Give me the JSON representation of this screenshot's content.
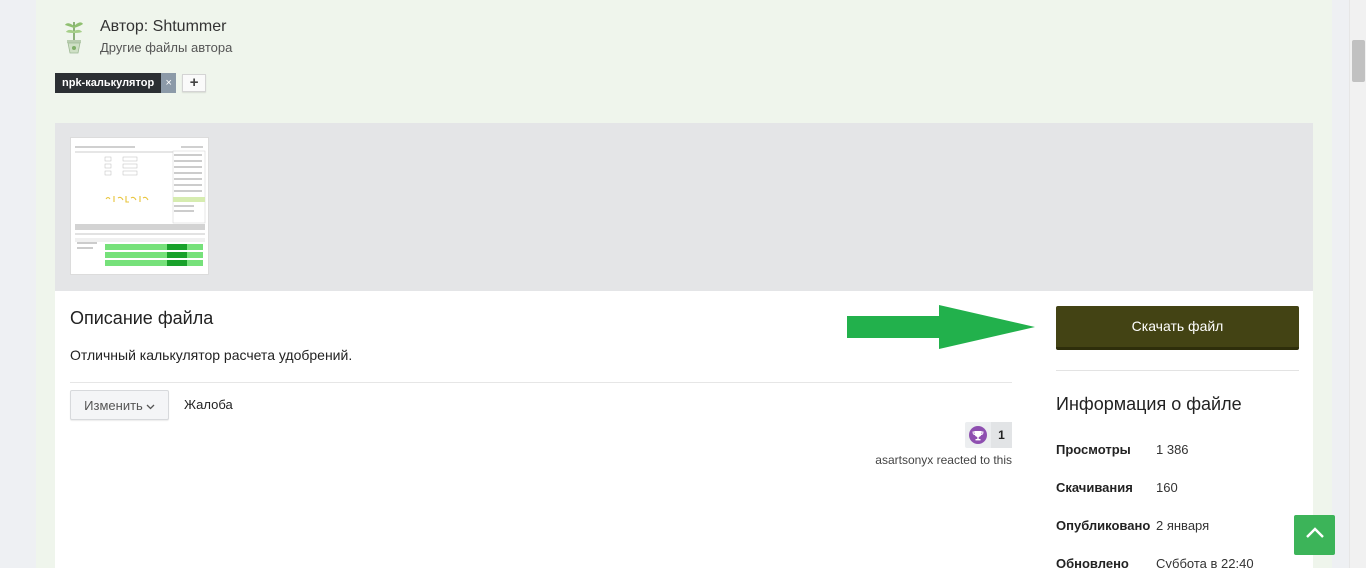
{
  "author": {
    "name_line": "Автор: Shtummer",
    "other_files": "Другие файлы автора"
  },
  "tags": {
    "items": [
      "npk-калькулятор"
    ],
    "remove_symbol": "×",
    "add_symbol": "+"
  },
  "file": {
    "description_title": "Описание файла",
    "description_text": "Отличный калькулятор расчета удобрений.",
    "edit_label": "Изменить",
    "report_label": "Жалоба",
    "reaction_count": "1",
    "reacted_text": "asartsonyx reacted to this"
  },
  "sidebar": {
    "download_label": "Скачать файл",
    "info_title": "Информация о файле",
    "rows": [
      {
        "key": "Просмотры",
        "value": "1 386"
      },
      {
        "key": "Скачивания",
        "value": "160"
      },
      {
        "key": "Опубликовано",
        "value": "2 января"
      },
      {
        "key": "Обновлено",
        "value": "Суббота в 22:40"
      }
    ]
  },
  "colors": {
    "download_button": "#434314",
    "arrow": "#22b14c",
    "back_to_top": "#3cb459",
    "reaction_badge": "#8e4fb0"
  },
  "icons": {
    "author_avatar": "plant-pot-icon",
    "reaction": "trophy-icon",
    "dropdown": "chevron-down-icon",
    "back_to_top": "chevron-up-icon"
  }
}
